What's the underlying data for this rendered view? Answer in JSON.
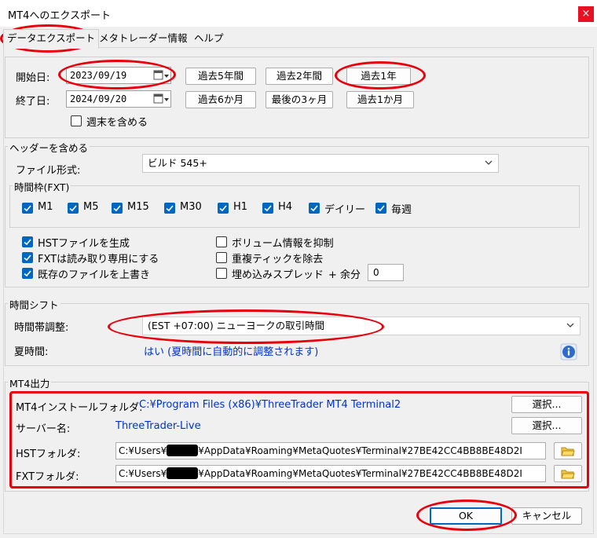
{
  "window": {
    "title": "MT4へのエクスポート",
    "close": "×"
  },
  "tabs": [
    "データエクスポート",
    "メタトレーダー情報",
    "ヘルプ"
  ],
  "dates": {
    "start_label": "開始日:",
    "start_value": "2023/09/19",
    "end_label": "終了日:",
    "end_value": "2024/09/20",
    "weekend_label": "週末を含める",
    "weekend_checked": false
  },
  "range_buttons": {
    "row1": [
      "過去5年間",
      "過去2年間",
      "過去1年"
    ],
    "row2": [
      "過去6か月",
      "最後の3ヶ月",
      "過去1か月"
    ]
  },
  "header": {
    "legend": "ヘッダーを含める",
    "format_label": "ファイル形式:",
    "format_value": "ビルド 545+"
  },
  "timeframes": {
    "legend": "時間枠(FXT)",
    "items": [
      "M1",
      "M5",
      "M15",
      "M30",
      "H1",
      "H4",
      "デイリー",
      "毎週"
    ]
  },
  "options": {
    "hst": "HSTファイルを生成",
    "fxt_readonly": "FXTは読み取り専用にする",
    "overwrite": "既存のファイルを上書き",
    "suppress_volume": "ボリューム情報を抑制",
    "remove_duplicates": "重複ティックを除去",
    "pad_spread": "埋め込みスプレッド",
    "margin_label": "+ 余分",
    "margin_value": "0"
  },
  "timeshift": {
    "legend": "時間シフト",
    "tz_label": "時間帯調整:",
    "tz_value": "(EST +07:00) ニューヨークの取引時間",
    "dst_label": "夏時間:",
    "dst_value": "はい (夏時間に自動的に調整されます)"
  },
  "output": {
    "legend": "MT4出力",
    "install_label": "MT4インストールフォルダ:",
    "install_value": "C:¥Program Files (x86)¥ThreeTrader MT4 Terminal2",
    "server_label": "サーバー名:",
    "server_value": "ThreeTrader-Live",
    "select_label": "選択...",
    "hst_label": "HSTフォルダ:",
    "fxt_label": "FXTフォルダ:",
    "path_prefix": "C:¥Users¥",
    "path_suffix": "¥AppData¥Roaming¥MetaQuotes¥Terminal¥27BE42CC4BB8BE48D2I"
  },
  "footer": {
    "ok": "OK",
    "cancel": "キャンセル"
  },
  "colors": {
    "accent": "#0067c0",
    "highlight": "#e8000b",
    "link_text": "#0033cc"
  }
}
